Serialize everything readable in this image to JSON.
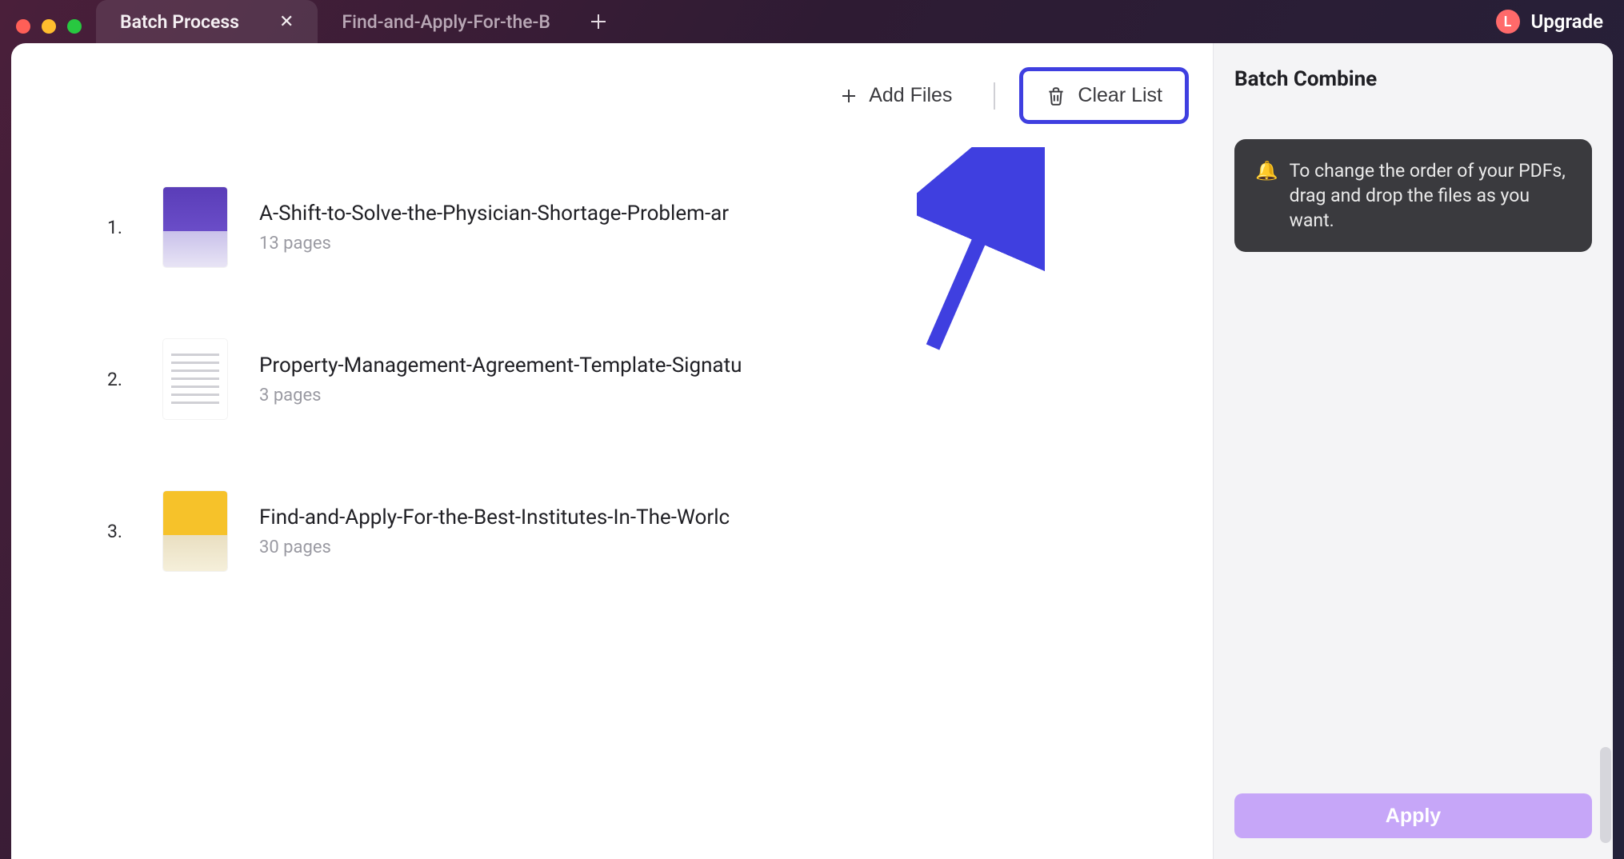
{
  "tabs": {
    "active": {
      "label": "Batch Process"
    },
    "inactive": {
      "label": "Find-and-Apply-For-the-B"
    }
  },
  "header": {
    "avatar_initial": "L",
    "upgrade_label": "Upgrade"
  },
  "toolbar": {
    "add_files_label": "Add Files",
    "clear_list_label": "Clear List"
  },
  "files": [
    {
      "index": "1.",
      "name": "A-Shift-to-Solve-the-Physician-Shortage-Problem-ar",
      "pages": "13 pages",
      "thumb": "t1"
    },
    {
      "index": "2.",
      "name": "Property-Management-Agreement-Template-Signatu",
      "pages": "3 pages",
      "thumb": "t2"
    },
    {
      "index": "3.",
      "name": "Find-and-Apply-For-the-Best-Institutes-In-The-Worlc",
      "pages": "30 pages",
      "thumb": "t3"
    }
  ],
  "panel": {
    "title": "Batch Combine",
    "tip_icon": "🔔",
    "tip_text": "To change the order of your PDFs, drag and drop the files as you want.",
    "apply_label": "Apply"
  },
  "colors": {
    "accent": "#3f3fe0",
    "apply_bg": "#c6a6f8"
  }
}
